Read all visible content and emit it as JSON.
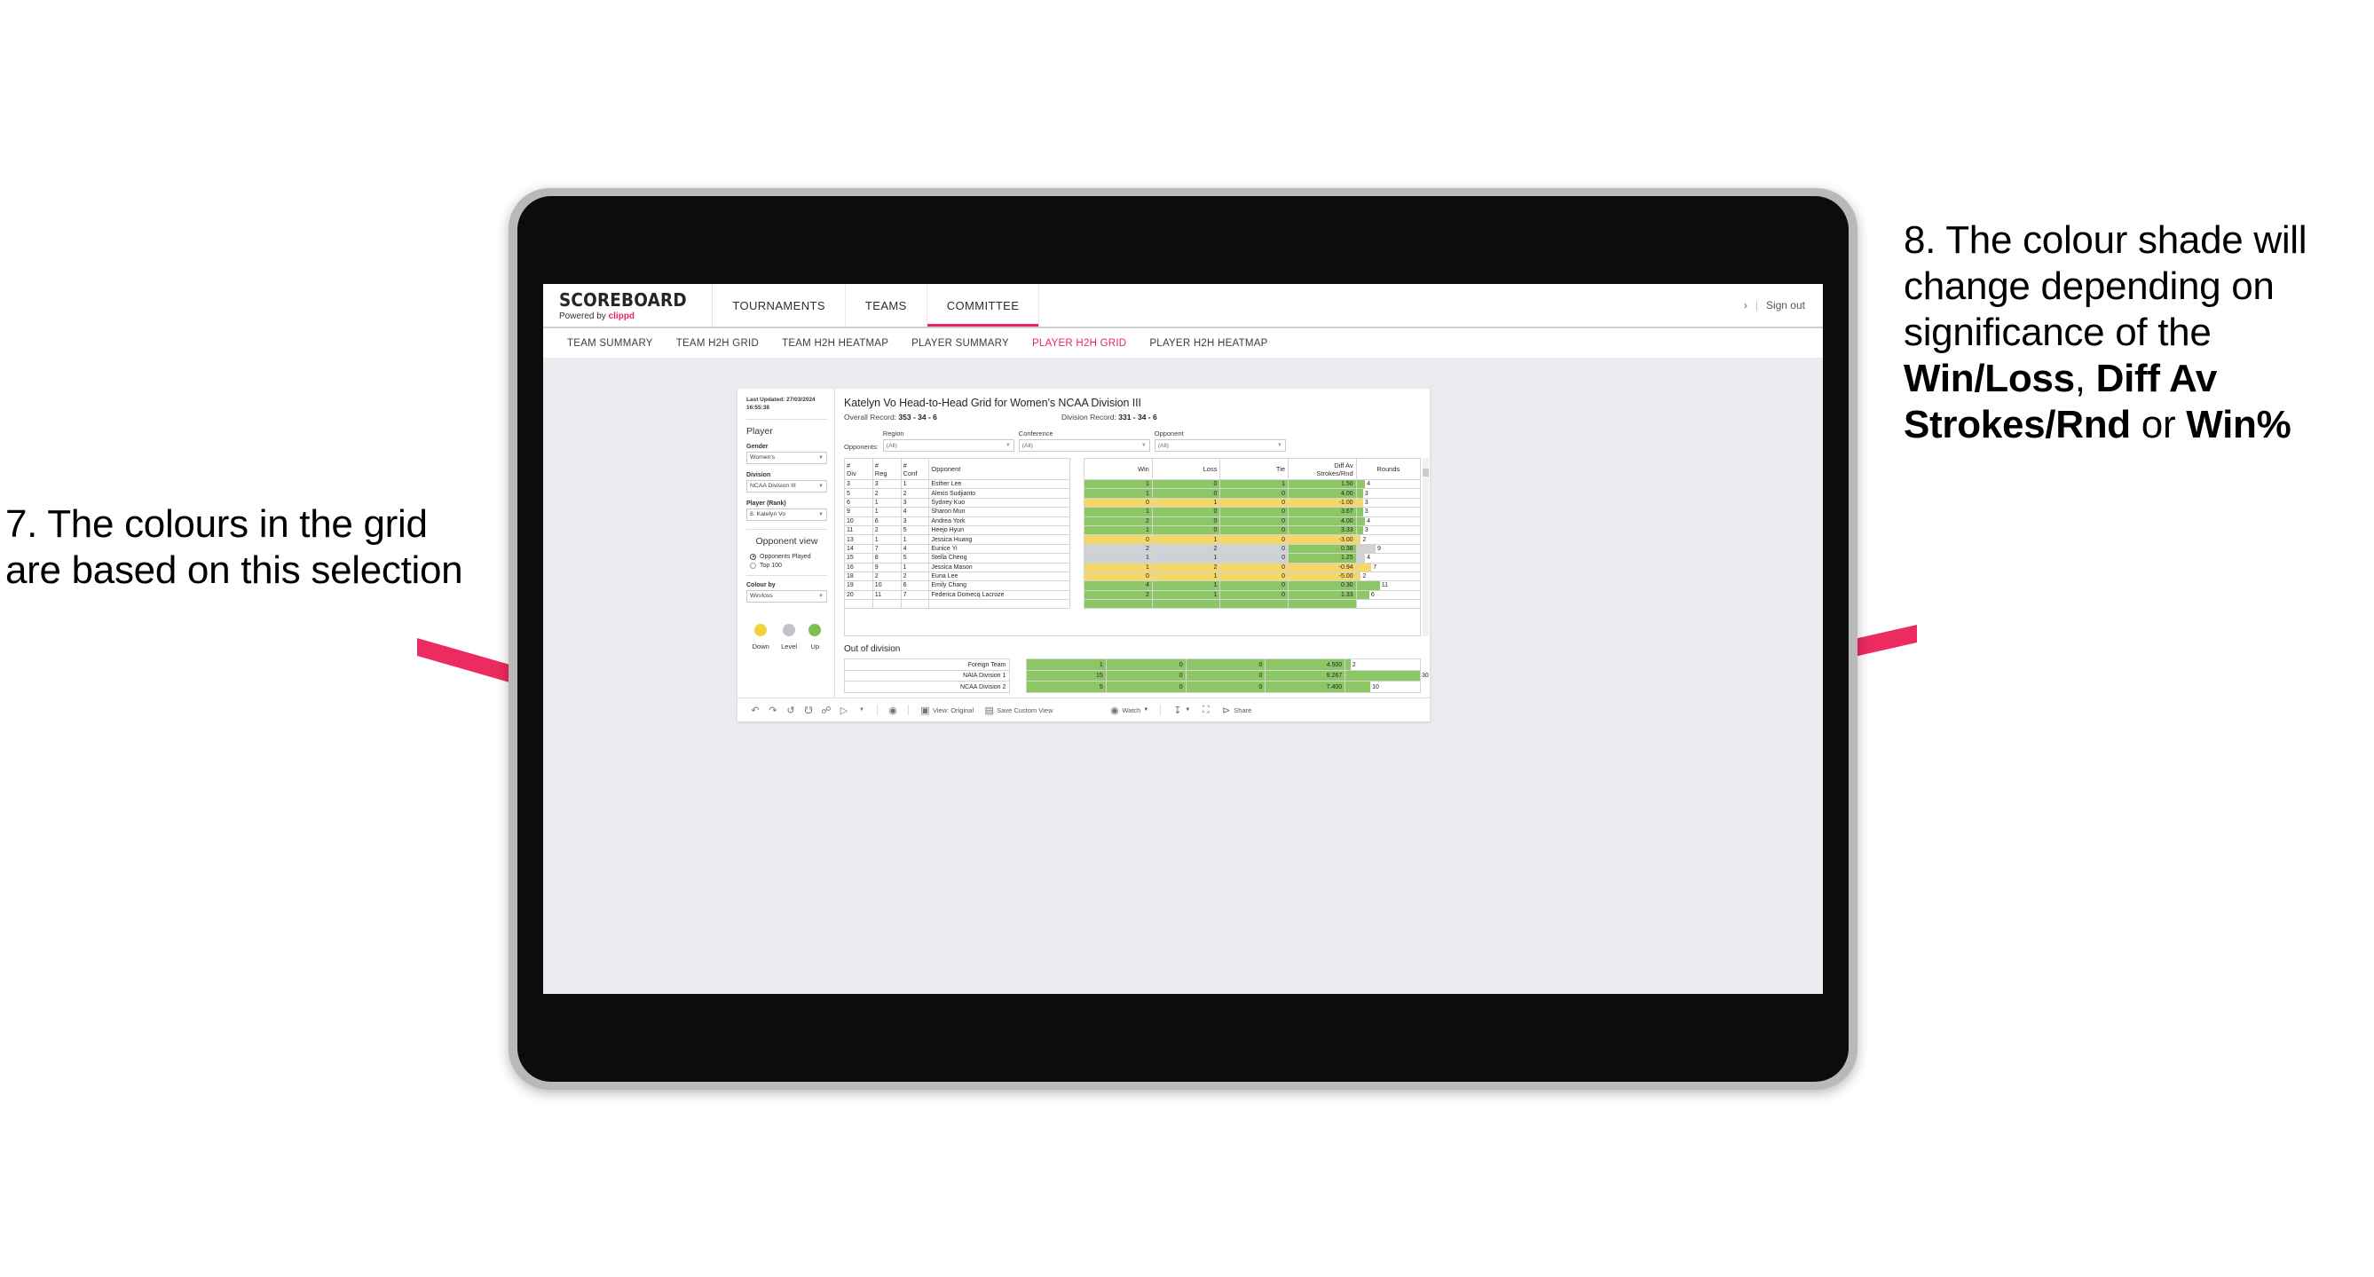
{
  "annotations": {
    "left": {
      "id": "7.",
      "text": "7. The colours in the grid are based on this selection"
    },
    "right": {
      "id": "8.",
      "prefix": "8. The colour shade will change depending on significance of the ",
      "bold1": "Win/Loss",
      "mid1": ", ",
      "bold2": "Diff Av Strokes/Rnd",
      "mid2": " or ",
      "bold3": "Win%"
    },
    "arrow_color": "#ec2b60"
  },
  "app": {
    "brand": {
      "title": "SCOREBOARD",
      "powered_prefix": "Powered by ",
      "powered_name": "clippd"
    },
    "topnav": [
      {
        "label": "TOURNAMENTS",
        "active": false
      },
      {
        "label": "TEAMS",
        "active": false
      },
      {
        "label": "COMMITTEE",
        "active": true
      }
    ],
    "topright": {
      "chevron": "›",
      "divider": "|",
      "signout": "Sign out"
    },
    "subnav": [
      {
        "label": "TEAM SUMMARY",
        "active": false
      },
      {
        "label": "TEAM H2H GRID",
        "active": false
      },
      {
        "label": "TEAM H2H HEATMAP",
        "active": false
      },
      {
        "label": "PLAYER SUMMARY",
        "active": false
      },
      {
        "label": "PLAYER H2H GRID",
        "active": true
      },
      {
        "label": "PLAYER H2H HEATMAP",
        "active": false
      }
    ],
    "accent": "#e8265f"
  },
  "sidebar": {
    "last_updated": "Last Updated: 27/03/2024 16:55:38",
    "player_heading": "Player",
    "fields": [
      {
        "label": "Gender",
        "value": "Women’s"
      },
      {
        "label": "Division",
        "value": "NCAA Division III"
      },
      {
        "label": "Player (Rank)",
        "value": "8. Katelyn Vo"
      }
    ],
    "opponent_view": {
      "heading": "Opponent view",
      "options": [
        {
          "label": "Opponents Played",
          "selected": true
        },
        {
          "label": "Top 100",
          "selected": false
        }
      ]
    },
    "colour_by": {
      "label": "Colour by",
      "value": "Win/loss"
    },
    "legend": [
      {
        "label": "Down",
        "color": "#f3d03e"
      },
      {
        "label": "Level",
        "color": "#bfc3c7"
      },
      {
        "label": "Up",
        "color": "#7fbf4d"
      }
    ]
  },
  "main": {
    "title": "Katelyn Vo Head-to-Head Grid for Women’s NCAA Division III",
    "overall_record_label": "Overall Record: ",
    "overall_record_value": "353 - 34 - 6",
    "division_record_label": "Division Record: ",
    "division_record_value": "331 - 34 - 6",
    "opponents_label": "Opponents:",
    "filters": [
      {
        "caption": "Region",
        "value": "(All)"
      },
      {
        "caption": "Conference",
        "value": "(All)"
      },
      {
        "caption": "Opponent",
        "value": "(All)"
      }
    ],
    "out_of_division_title": "Out of division"
  },
  "chart_data": {
    "type": "table",
    "title": "Katelyn Vo Head-to-Head Grid for Women’s NCAA Division III",
    "columns": [
      "# Div",
      "# Reg",
      "# Conf",
      "Opponent",
      "Win",
      "Loss",
      "Tie",
      "Diff Av Strokes/Rnd",
      "Rounds"
    ],
    "column_header_lines": [
      [
        "#",
        "Div"
      ],
      [
        "#",
        "Reg"
      ],
      [
        "#",
        "Conf"
      ],
      [
        "Opponent"
      ],
      [
        "Win"
      ],
      [
        "Loss"
      ],
      [
        "Tie"
      ],
      [
        "Diff Av",
        "Strokes/Rnd"
      ],
      [
        "Rounds"
      ]
    ],
    "rounds_max": 30,
    "colors": {
      "up": "#8cc665",
      "down": "#f5d669",
      "level": "#cfd2d4"
    },
    "rows": [
      {
        "div": "3",
        "reg": "3",
        "conf": "1",
        "opponent": "Esther Lee",
        "win": "1",
        "loss": "0",
        "tie": "1",
        "diff": "1.50",
        "rounds": "4",
        "shade": "up"
      },
      {
        "div": "5",
        "reg": "2",
        "conf": "2",
        "opponent": "Alexis Sudjianto",
        "win": "1",
        "loss": "0",
        "tie": "0",
        "diff": "4.00",
        "rounds": "3",
        "shade": "up"
      },
      {
        "div": "6",
        "reg": "1",
        "conf": "3",
        "opponent": "Sydney Kuo",
        "win": "0",
        "loss": "1",
        "tie": "0",
        "diff": "-1.00",
        "rounds": "3",
        "shade": "down"
      },
      {
        "div": "9",
        "reg": "1",
        "conf": "4",
        "opponent": "Sharon Mun",
        "win": "1",
        "loss": "0",
        "tie": "0",
        "diff": "3.67",
        "rounds": "3",
        "shade": "up"
      },
      {
        "div": "10",
        "reg": "6",
        "conf": "3",
        "opponent": "Andrea York",
        "win": "2",
        "loss": "0",
        "tie": "0",
        "diff": "4.00",
        "rounds": "4",
        "shade": "up"
      },
      {
        "div": "11",
        "reg": "2",
        "conf": "5",
        "opponent": "Heejo Hyun",
        "win": "1",
        "loss": "0",
        "tie": "0",
        "diff": "3.33",
        "rounds": "3",
        "shade": "up"
      },
      {
        "div": "13",
        "reg": "1",
        "conf": "1",
        "opponent": "Jessica Huang",
        "win": "0",
        "loss": "1",
        "tie": "0",
        "diff": "-3.00",
        "rounds": "2",
        "shade": "down"
      },
      {
        "div": "14",
        "reg": "7",
        "conf": "4",
        "opponent": "Eunice Yi",
        "win": "2",
        "loss": "2",
        "tie": "0",
        "diff": "0.38",
        "rounds": "9",
        "shade": "level",
        "diff_shade": "up"
      },
      {
        "div": "15",
        "reg": "8",
        "conf": "5",
        "opponent": "Stella Cheng",
        "win": "1",
        "loss": "1",
        "tie": "0",
        "diff": "1.25",
        "rounds": "4",
        "shade": "level",
        "diff_shade": "up"
      },
      {
        "div": "16",
        "reg": "9",
        "conf": "1",
        "opponent": "Jessica Mason",
        "win": "1",
        "loss": "2",
        "tie": "0",
        "diff": "-0.94",
        "rounds": "7",
        "shade": "down"
      },
      {
        "div": "18",
        "reg": "2",
        "conf": "2",
        "opponent": "Euna Lee",
        "win": "0",
        "loss": "1",
        "tie": "0",
        "diff": "-5.00",
        "rounds": "2",
        "shade": "down"
      },
      {
        "div": "19",
        "reg": "10",
        "conf": "6",
        "opponent": "Emily Chang",
        "win": "4",
        "loss": "1",
        "tie": "0",
        "diff": "0.30",
        "rounds": "11",
        "shade": "up"
      },
      {
        "div": "20",
        "reg": "11",
        "conf": "7",
        "opponent": "Federica Domecq Lacroze",
        "win": "2",
        "loss": "1",
        "tie": "0",
        "diff": "1.33",
        "rounds": "6",
        "shade": "up"
      }
    ],
    "out_of_division": {
      "title": "Out of division",
      "rows": [
        {
          "label": "Foreign Team",
          "win": "1",
          "loss": "0",
          "tie": "0",
          "diff": "4.500",
          "rounds": "2",
          "shade": "up"
        },
        {
          "label": "NAIA Division 1",
          "win": "15",
          "loss": "0",
          "tie": "0",
          "diff": "9.267",
          "rounds": "30",
          "shade": "up"
        },
        {
          "label": "NCAA Division 2",
          "win": "5",
          "loss": "0",
          "tie": "0",
          "diff": "7.400",
          "rounds": "10",
          "shade": "up"
        }
      ]
    }
  },
  "toolbar": {
    "icons": [
      "undo-icon",
      "redo-icon",
      "revert-icon",
      "refresh-data-icon",
      "pause-icon",
      "highlight-icon",
      "chevron-down-icon",
      "clear-icon"
    ],
    "view_label": "View: Original",
    "save_custom_view_label": "Save Custom View",
    "watch_label": "Watch",
    "share_label": "Share"
  }
}
